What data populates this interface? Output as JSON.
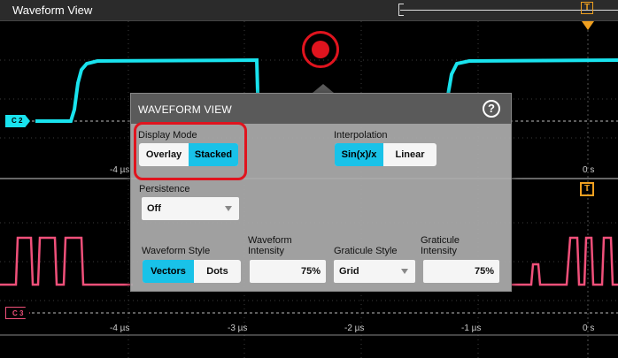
{
  "window": {
    "title": "Waveform View"
  },
  "graticule": {
    "upper_ticks": [
      "-4 µs",
      "0 s"
    ],
    "lower_ticks": [
      "-4 µs",
      "-3 µs",
      "-2 µs",
      "-1 µs",
      "0 s"
    ],
    "channels": [
      {
        "label": "C 2",
        "color": "#19e3ee"
      },
      {
        "label": "C 3",
        "color": "#f0507a"
      }
    ],
    "trigger_markers": {
      "top": "T",
      "mid": "T"
    },
    "trigger_color": "#f0a020"
  },
  "dialog": {
    "title": "WAVEFORM VIEW",
    "help_label": "?",
    "display_mode": {
      "label": "Display Mode",
      "options": [
        "Overlay",
        "Stacked"
      ],
      "selected": "Stacked"
    },
    "interpolation": {
      "label": "Interpolation",
      "options": [
        "Sin(x)/x",
        "Linear"
      ],
      "selected": "Sin(x)/x"
    },
    "persistence": {
      "label": "Persistence",
      "value": "Off"
    },
    "waveform_style": {
      "label": "Waveform Style",
      "options": [
        "Vectors",
        "Dots"
      ],
      "selected": "Vectors"
    },
    "waveform_intensity": {
      "label_line1": "Waveform",
      "label_line2": "Intensity",
      "value": "75%"
    },
    "graticule_style": {
      "label": "Graticule Style",
      "value": "Grid"
    },
    "graticule_intensity": {
      "label_line1": "Graticule",
      "label_line2": "Intensity",
      "value": "75%"
    }
  },
  "colors": {
    "accent": "#19c2e8",
    "highlight": "#e0141e"
  }
}
